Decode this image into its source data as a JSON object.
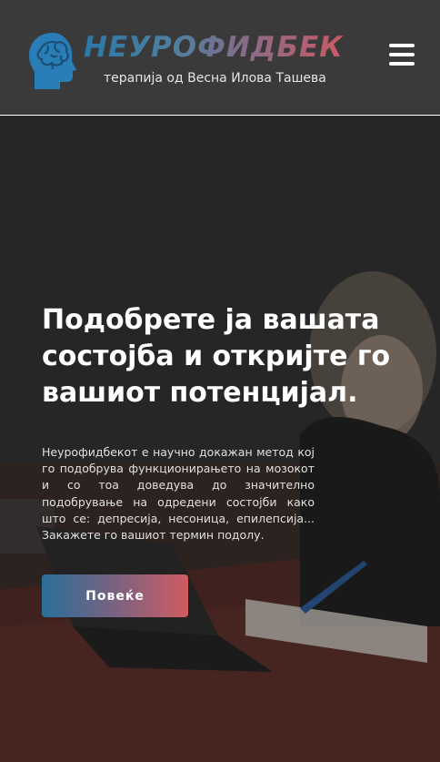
{
  "header": {
    "brand_title": "НЕУРОФИДБЕК",
    "brand_subtitle": "терапија од Весна Илова Ташева",
    "menu_icon": "hamburger-menu-icon"
  },
  "hero": {
    "headline": "Подобрете ја вашата состојба и откријте го вашиот потенцијал.",
    "body": "Неурофидбекот е научно докажан метод кој го подобрува функционирањето на мозокот и со тоа доведува до значително подобрување на одредени состојби како што се: депресија, несоница, епилепсија... Закажете го вашиот термин подолу.",
    "cta_label": "Повеќе"
  },
  "colors": {
    "header_bg": "#3a3a3a",
    "brand_gradient_start": "#2a78a8",
    "brand_gradient_end": "#c85a63",
    "text_light": "#ffffff"
  }
}
